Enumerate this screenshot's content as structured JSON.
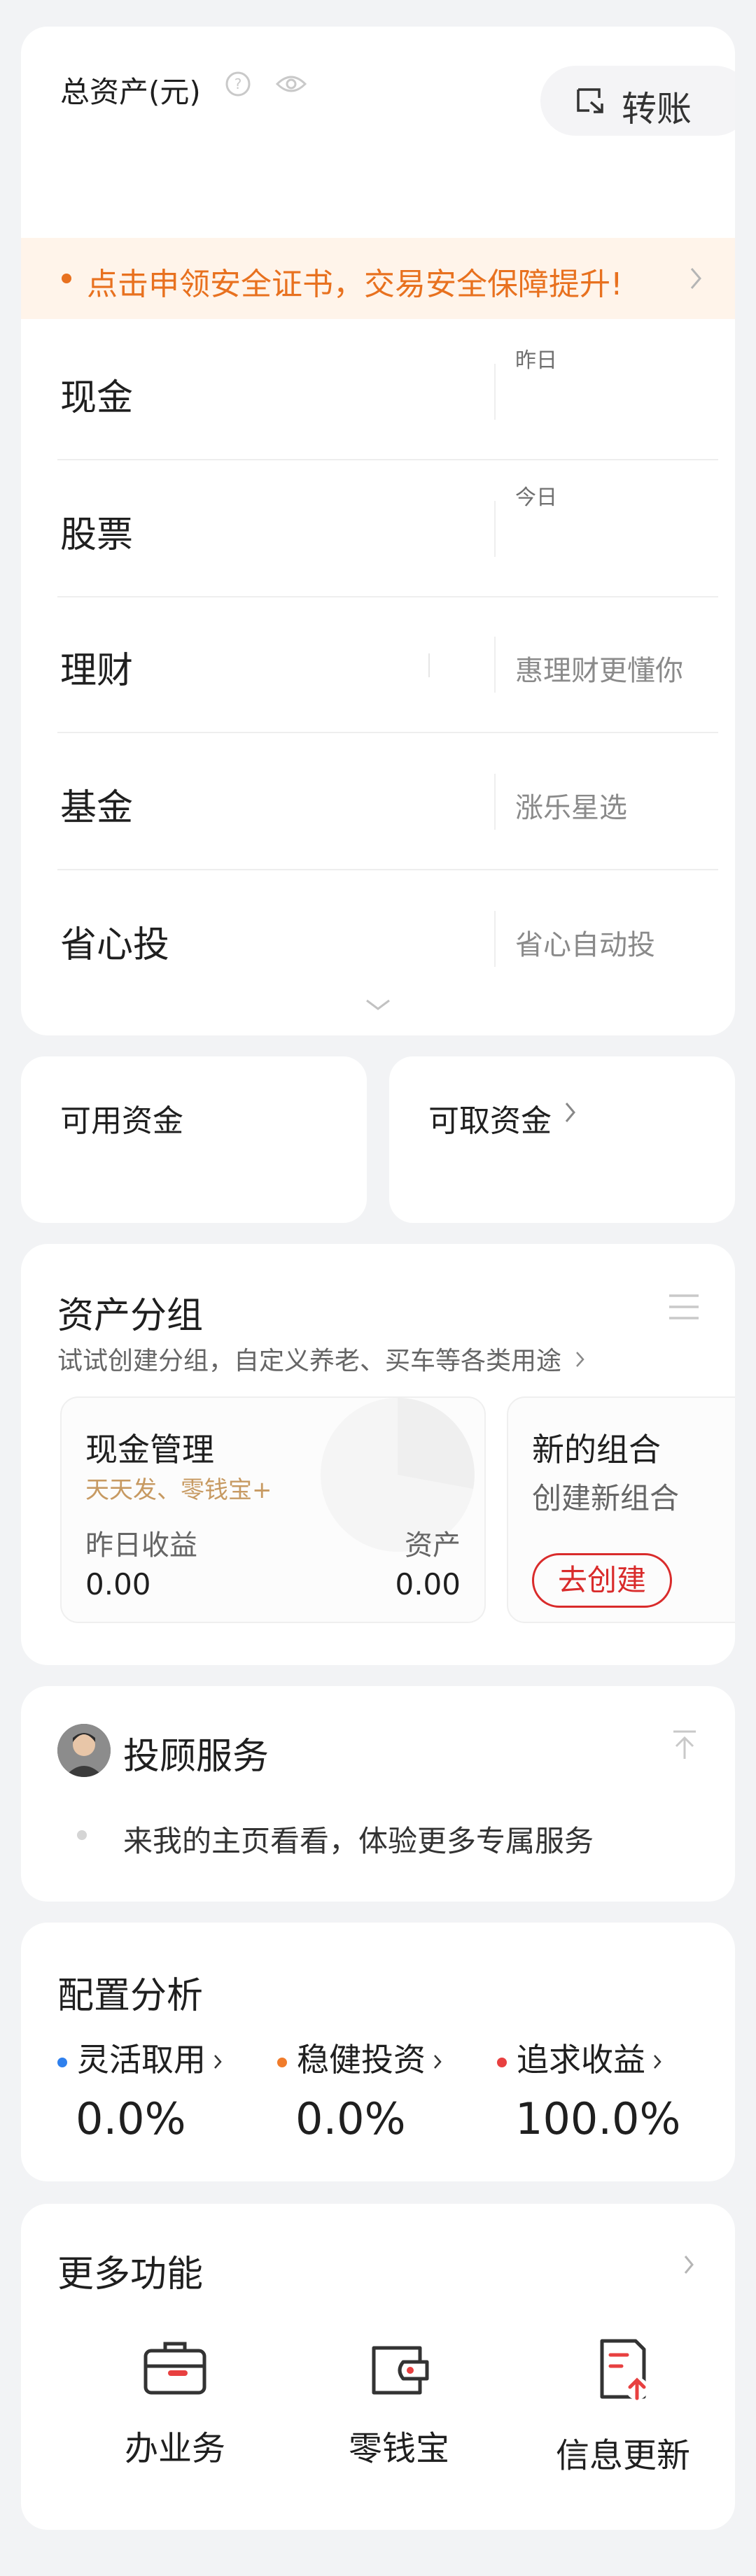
{
  "assets": {
    "title": "总资产(元)",
    "transfer_label": "转账",
    "banner_text": "点击申领安全证书，交易安全保障提升!",
    "rows": [
      {
        "label": "现金",
        "tag": "昨日",
        "right": ""
      },
      {
        "label": "股票",
        "tag": "今日",
        "right": ""
      },
      {
        "label": "理财",
        "tag": "",
        "right": "惠理财更懂你"
      },
      {
        "label": "基金",
        "tag": "",
        "right": "涨乐星选"
      },
      {
        "label": "省心投",
        "tag": "",
        "right": "省心自动投"
      }
    ]
  },
  "funds": {
    "available_label": "可用资金",
    "withdrawable_label": "可取资金"
  },
  "groups": {
    "title": "资产分组",
    "subtitle": "试试创建分组，自定义养老、买车等各类用途",
    "cash": {
      "title": "现金管理",
      "subtitle": "天天发、零钱宝+",
      "yield_label": "昨日收益",
      "yield_value": "0.00",
      "asset_label": "资产",
      "asset_value": "0.00"
    },
    "new_combo": {
      "title": "新的组合",
      "subtitle": "创建新组合",
      "button": "去创建"
    }
  },
  "advisor": {
    "title": "投顾服务",
    "message": "来我的主页看看，体验更多专属服务"
  },
  "config": {
    "title": "配置分析",
    "items": [
      {
        "label": "灵活取用",
        "value": "0.0%",
        "color": "#2f80ed"
      },
      {
        "label": "稳健投资",
        "value": "0.0%",
        "color": "#f07c2b"
      },
      {
        "label": "追求收益",
        "value": "100.0%",
        "color": "#e84040"
      }
    ]
  },
  "more": {
    "title": "更多功能",
    "items": [
      {
        "label": "办业务",
        "icon": "briefcase-icon"
      },
      {
        "label": "零钱宝",
        "icon": "wallet-icon"
      },
      {
        "label": "信息更新",
        "icon": "document-update-icon"
      }
    ]
  },
  "colors": {
    "accent_orange": "#e8711f",
    "banner_bg": "#fff4ea",
    "red": "#d92b2b"
  }
}
